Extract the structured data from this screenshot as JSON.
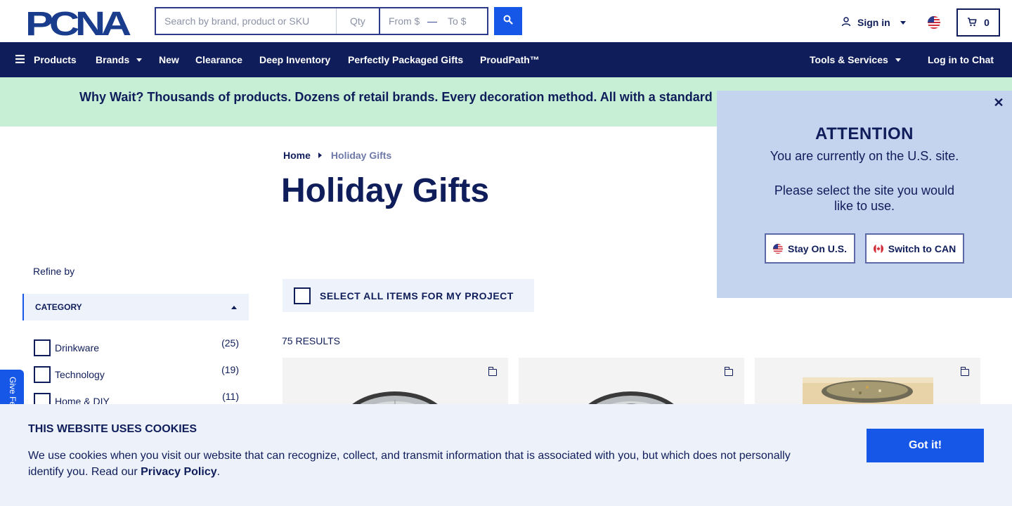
{
  "header": {
    "logo_text": "PCNA",
    "search": {
      "placeholder": "Search by brand, product or SKU",
      "value": ""
    },
    "quantity": {
      "placeholder": "Qty"
    },
    "price_from": {
      "placeholder": "From $"
    },
    "price_to": {
      "placeholder": "To $"
    },
    "sign_in_label": "Sign in",
    "cart_count": "0"
  },
  "nav": {
    "items": [
      {
        "label": "Products"
      },
      {
        "label": "Brands"
      },
      {
        "label": "New"
      },
      {
        "label": "Clearance"
      },
      {
        "label": "Deep Inventory"
      },
      {
        "label": "Perfectly Packaged Gifts"
      },
      {
        "label": "ProudPath™"
      }
    ],
    "tools_label": "Tools & Services",
    "chat_label": "Log in to Chat"
  },
  "promo": {
    "text": "Why Wait? Thousands of products. Dozens of retail brands. Every decoration method. All with a standard"
  },
  "breadcrumb": {
    "home": "Home",
    "current": "Holiday Gifts"
  },
  "page": {
    "title": "Holiday Gifts",
    "refine_label": "Refine by",
    "select_all_label": "SELECT ALL ITEMS FOR MY PROJECT",
    "results_label": "75 RESULTS"
  },
  "filters": {
    "category": {
      "label": "CATEGORY",
      "items": [
        {
          "label": "Drinkware",
          "count": "(25)",
          "checked": false
        },
        {
          "label": "Technology",
          "count": "(19)",
          "checked": false
        },
        {
          "label": "Home & DIY",
          "count": "(11)",
          "checked": false
        }
      ]
    }
  },
  "attention": {
    "title": "ATTENTION",
    "line1": "You are currently on the U.S. site.",
    "line2": "Please select the site you would like to use.",
    "stay_label": "Stay On U.S.",
    "switch_label": "Switch to CAN"
  },
  "feedback": {
    "label": "Give Feedback"
  },
  "cookies": {
    "title": "THIS WEBSITE USES COOKIES",
    "text": "We use cookies when you visit our website that can recognize, collect, and transmit information that is associated with you, but which does not personally identify you. Read our ",
    "link": "Privacy Policy",
    "end": ".",
    "accept": "Got it!"
  },
  "colors": {
    "navy": "#0f1d5a",
    "accent_blue": "#1657e8",
    "promo_green": "#c6efd6",
    "popup_bg": "#c4d3ee",
    "cookie_bg": "#edf1fa"
  }
}
